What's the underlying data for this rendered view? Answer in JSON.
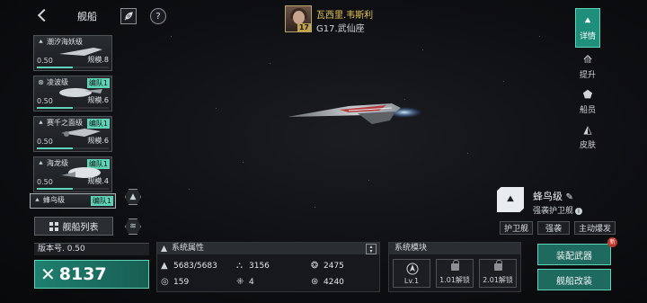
{
  "header": {
    "title": "舰船",
    "back_icon": "chevron-left-icon",
    "tool1_icon": "feather-icon",
    "tool2_icon": "question-icon",
    "tool2_symbol": "?"
  },
  "captain": {
    "name": "瓦西里.韦斯利",
    "level": "17",
    "subtitle": "G17.武仙座"
  },
  "ship_list": [
    {
      "name": "潮汐海妖级",
      "value": "0.50",
      "scale": "规模.8",
      "team": "",
      "icon": "ship-class-icon"
    },
    {
      "name": "凌波级",
      "value": "0.50",
      "scale": "规模.6",
      "team": "编队1",
      "icon": "target-icon"
    },
    {
      "name": "赛千之面级",
      "value": "0.50",
      "scale": "规模.6",
      "team": "编队1",
      "icon": "ship-class-icon"
    },
    {
      "name": "海龙级",
      "value": "0.50",
      "scale": "规模.4",
      "team": "编队1",
      "icon": "ship-class-icon"
    },
    {
      "name": "蜂鸟级",
      "value": "",
      "scale": "",
      "team": "编队1",
      "icon": "ship-class-icon"
    }
  ],
  "fleet_list_label": "舰船列表",
  "right_tabs": [
    {
      "label": "详情",
      "icon": "details-icon",
      "active": true
    },
    {
      "label": "提升",
      "icon": "upgrade-icon",
      "active": false
    },
    {
      "label": "船员",
      "icon": "crew-icon",
      "active": false
    },
    {
      "label": "皮肤",
      "icon": "skin-icon",
      "active": false
    }
  ],
  "ship_class": {
    "name": "蜂鸟级",
    "edit_icon": "pencil-icon",
    "subtitle": "强袭护卫舰",
    "info_symbol": "i",
    "tags": [
      "护卫舰",
      "强袭",
      "主动爆发"
    ]
  },
  "version_label": "版本号. 0.50",
  "power": {
    "value": "8137",
    "icon": "crossed-swords-icon"
  },
  "attributes": {
    "title": "系统属性",
    "items": [
      {
        "icon": "hull-icon",
        "value": "5683/5683"
      },
      {
        "icon": "armor-icon",
        "value": "3156"
      },
      {
        "icon": "shield-icon",
        "value": "2475"
      },
      {
        "icon": "speed-icon",
        "value": "159"
      },
      {
        "icon": "grid-icon",
        "value": "4"
      },
      {
        "icon": "energy-icon",
        "value": "4240"
      }
    ]
  },
  "system_modules": {
    "title": "系统模块",
    "modules": [
      {
        "label": "Lv.1",
        "locked": false,
        "icon": "module-icon"
      },
      {
        "label": "1.01解锁",
        "locked": true,
        "icon": "lock-icon"
      },
      {
        "label": "2.01解锁",
        "locked": true,
        "icon": "lock-icon"
      }
    ]
  },
  "actions": {
    "equip_weapon": "装配武器",
    "refit": "舰船改装",
    "new_badge": "新"
  },
  "colors": {
    "accent": "#5fd3b7",
    "accent_dark": "#1f6a5e",
    "gold": "#e7c55a"
  }
}
